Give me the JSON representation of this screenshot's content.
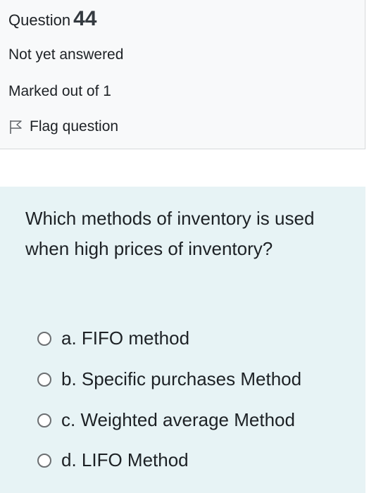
{
  "info": {
    "question_label": "Question",
    "question_number": "44",
    "state": "Not yet answered",
    "grade": "Marked out of 1",
    "flag_label": "Flag question",
    "flag_icon": "flag-outline-icon"
  },
  "question": {
    "text": "Which methods of inventory is used when high prices of inventory?",
    "answers": [
      {
        "label": "a. FIFO method",
        "selected": false
      },
      {
        "label": "b. Specific purchases Method",
        "selected": false
      },
      {
        "label": "c. Weighted average Method",
        "selected": false
      },
      {
        "label": "d. LIFO Method",
        "selected": false
      }
    ]
  },
  "colors": {
    "info_background": "#f8f9fa",
    "formulation_background": "#e7f3f5",
    "text": "#1d2125"
  }
}
